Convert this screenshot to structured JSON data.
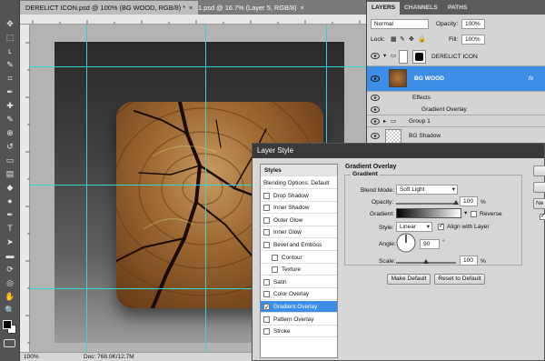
{
  "document_tabs": [
    {
      "label": "DERELICT ICON.psd @ 100% (BG WOOD, RGB/8) *",
      "close": "×"
    },
    {
      "label": "1.psd @ 16.7% (Layer 5, RGB/8)",
      "close": "×"
    }
  ],
  "status_bar": {
    "zoom": "100%",
    "doc": "Doc: 768.0K/12.7M"
  },
  "layers_panel": {
    "tabs": [
      "LAYERS",
      "CHANNELS",
      "PATHS"
    ],
    "blend_mode": "Normal",
    "opacity_label": "Opacity:",
    "opacity_value": "100%",
    "lock_label": "Lock:",
    "fill_label": "Fill:",
    "fill_value": "100%",
    "layers": {
      "derelict_icon": "DERELICT ICON",
      "bg_wood": "BG WOOD",
      "fx": "fx",
      "effects": "Effects",
      "gradient_overlay": "Gradient Overlay",
      "group1": "Group 1",
      "bg_shadow": "BG Shadow"
    }
  },
  "layer_style": {
    "title": "Layer Style",
    "list_header": "Styles",
    "items": [
      {
        "label": "Blending Options: Default",
        "checkbox": false,
        "checked": false,
        "indent": false
      },
      {
        "label": "Drop Shadow",
        "checkbox": true,
        "checked": false,
        "indent": false
      },
      {
        "label": "Inner Shadow",
        "checkbox": true,
        "checked": false,
        "indent": false
      },
      {
        "label": "Outer Glow",
        "checkbox": true,
        "checked": false,
        "indent": false
      },
      {
        "label": "Inner Glow",
        "checkbox": true,
        "checked": false,
        "indent": false
      },
      {
        "label": "Bevel and Emboss",
        "checkbox": true,
        "checked": false,
        "indent": false
      },
      {
        "label": "Contour",
        "checkbox": true,
        "checked": false,
        "indent": true
      },
      {
        "label": "Texture",
        "checkbox": true,
        "checked": false,
        "indent": true
      },
      {
        "label": "Satin",
        "checkbox": true,
        "checked": false,
        "indent": false
      },
      {
        "label": "Color Overlay",
        "checkbox": true,
        "checked": false,
        "indent": false
      },
      {
        "label": "Gradient Overlay",
        "checkbox": true,
        "checked": true,
        "indent": false
      },
      {
        "label": "Pattern Overlay",
        "checkbox": true,
        "checked": false,
        "indent": false
      },
      {
        "label": "Stroke",
        "checkbox": true,
        "checked": false,
        "indent": false
      }
    ],
    "section_title": "Gradient Overlay",
    "group_title": "Gradient",
    "blend_mode_label": "Blend Mode:",
    "blend_mode_value": "Soft Light",
    "opacity_label": "Opacity:",
    "opacity_value": "100",
    "opacity_percent": 100,
    "gradient_label": "Gradient:",
    "reverse_label": "Reverse",
    "style_label": "Style:",
    "style_value": "Linear",
    "align_label": "Align with Layer",
    "align_checked": true,
    "angle_label": "Angle:",
    "angle_value": "90",
    "angle_unit": "°",
    "scale_label": "Scale:",
    "scale_value": "100",
    "scale_percent": 100,
    "percent": "%",
    "make_default": "Make Default",
    "reset_default": "Reset to Default",
    "side_button_partial": "Ne"
  },
  "colors": {
    "selection": "#3d8ee6",
    "guide": "#33d6d6"
  }
}
